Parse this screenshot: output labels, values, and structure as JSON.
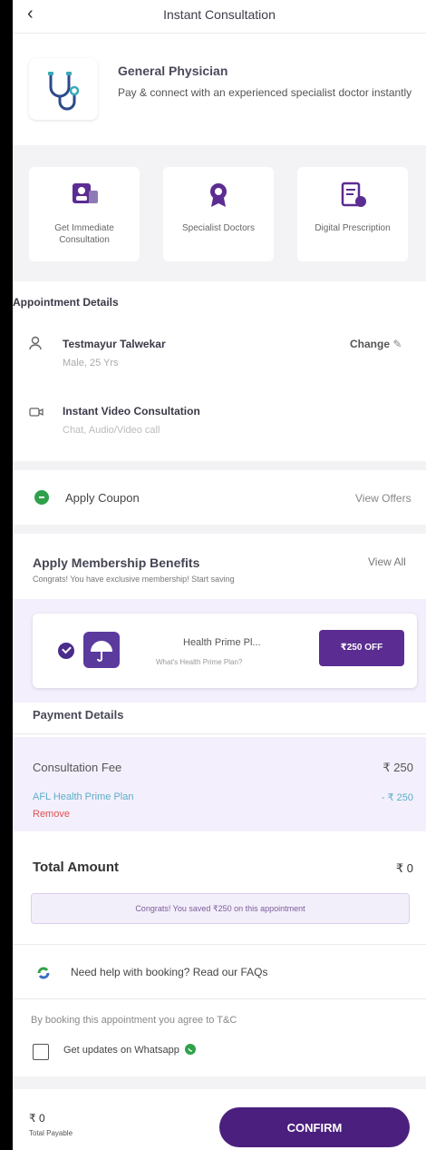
{
  "header": {
    "back_icon": "back-chevron-icon",
    "title": "Instant Consultation"
  },
  "physician": {
    "title": "General Physician",
    "description": "Pay & connect with an experienced specialist doctor instantly",
    "icon": "stethoscope-icon"
  },
  "features": [
    {
      "label": "Get Immediate Consultation",
      "icon": "consultation-icon"
    },
    {
      "label": "Specialist Doctors",
      "icon": "badge-icon"
    },
    {
      "label": "Digital Prescription",
      "icon": "prescription-icon"
    }
  ],
  "appointment": {
    "heading": "Appointment Details",
    "patient_name": "Testmayur Talwekar",
    "patient_info": "Male, 25 Yrs",
    "change_label": "Change",
    "consult_type": "Instant Video Consultation",
    "consult_modes": "Chat, Audio/Video call"
  },
  "coupon": {
    "label": "Apply Coupon",
    "view_offers": "View Offers"
  },
  "membership": {
    "title": "Apply Membership Benefits",
    "view_all": "View All",
    "note": "Congrats! You have exclusive membership! Start saving",
    "plan_name": "Health Prime Pl...",
    "plan_sub": "What's Health Prime Plan?",
    "off_label": "₹250 OFF"
  },
  "payment": {
    "heading": "Payment Details",
    "fee_label": "Consultation Fee",
    "fee_value": "₹ 250",
    "plan_label": "AFL Health Prime Plan",
    "plan_value": "- ₹ 250",
    "remove_label": "Remove",
    "total_label": "Total Amount",
    "total_value": "₹ 0",
    "saved_note": "Congrats! You saved ₹250 on this appointment"
  },
  "help": {
    "label": "Need help with booking? Read our FAQs"
  },
  "terms": {
    "text": "By booking this appointment you agree to T&C",
    "whatsapp_label": "Get updates on Whatsapp"
  },
  "footer": {
    "amount": "₹ 0",
    "amount_label": "Total Payable",
    "confirm_label": "CONFIRM"
  },
  "colors": {
    "primary": "#4b1f7d",
    "accent_green": "#2fa14a",
    "link_blue": "#5aaec8",
    "remove_red": "#e05050"
  }
}
